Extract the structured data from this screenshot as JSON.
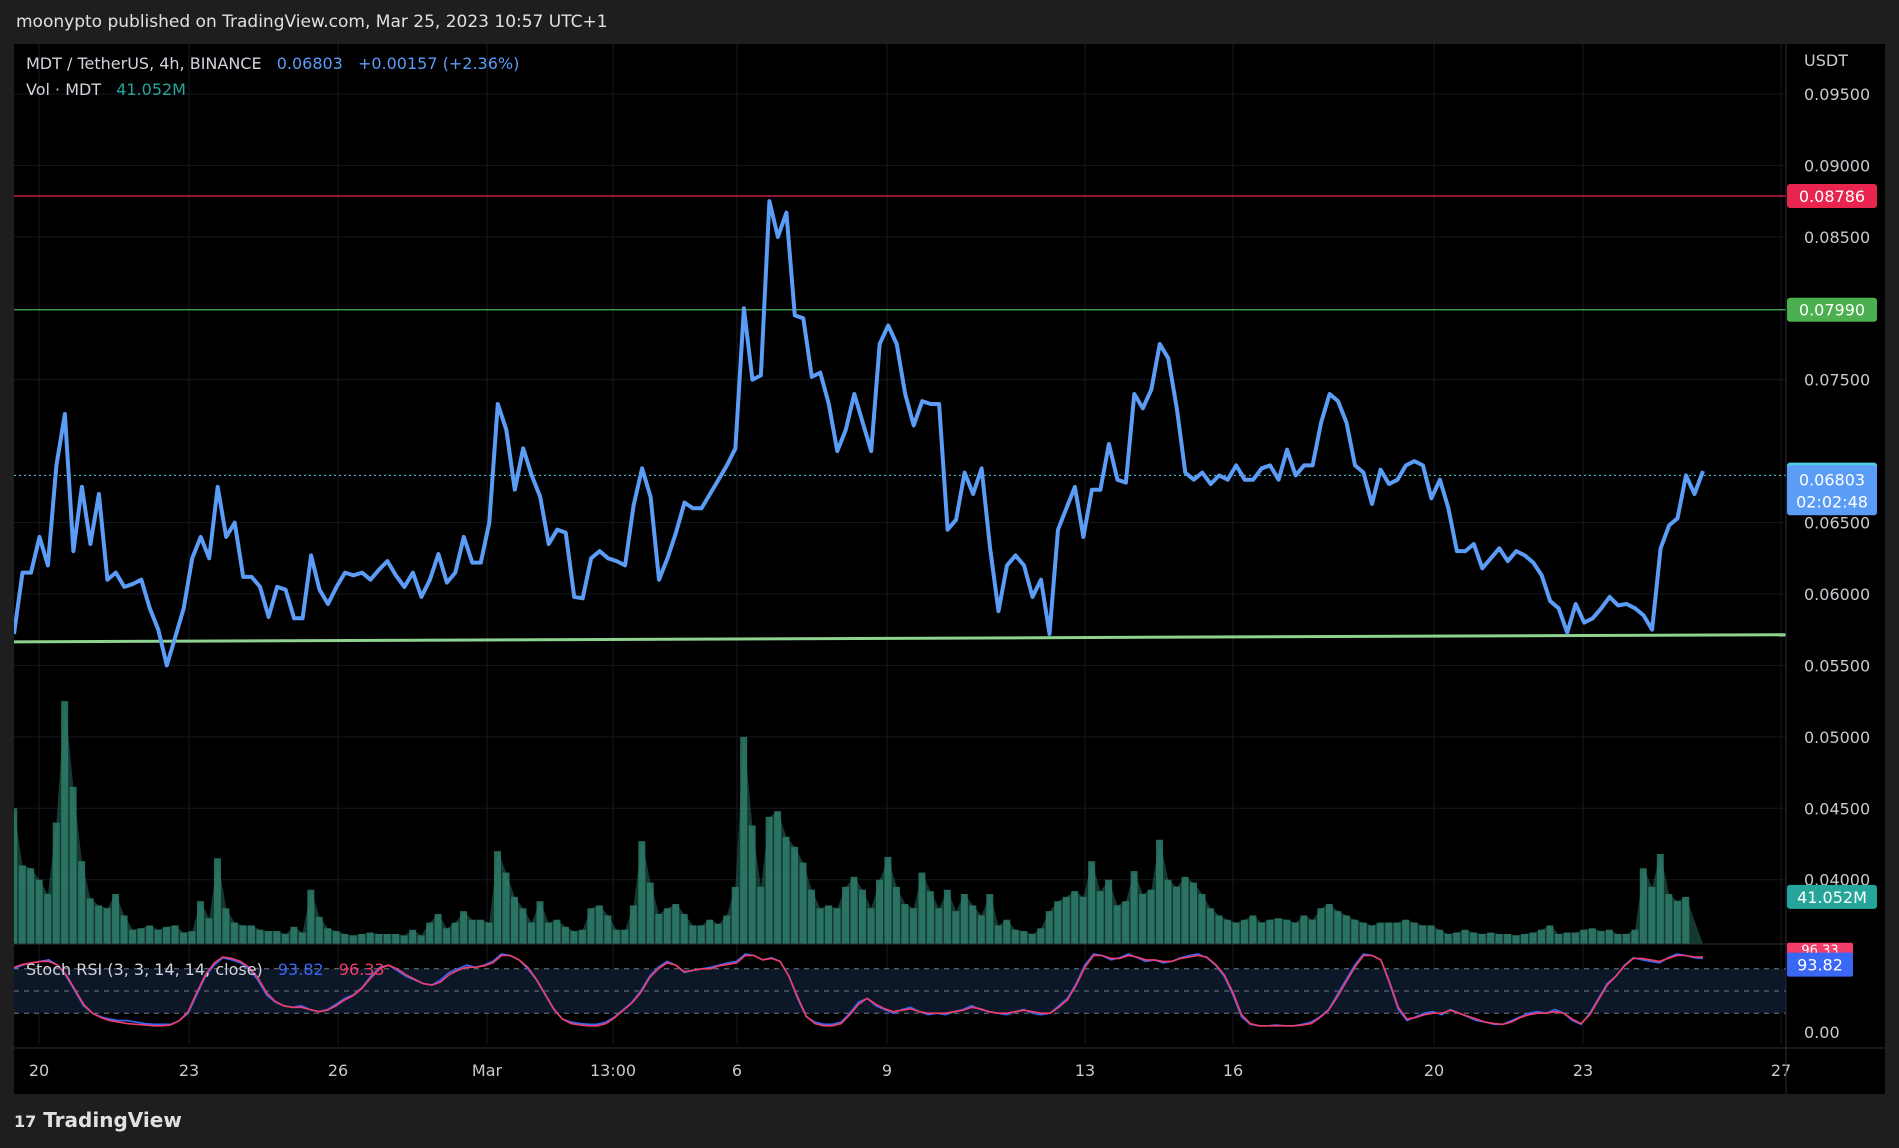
{
  "header": {
    "published_line": "moonypto published on TradingView.com, Mar 25, 2023 10:57 UTC+1"
  },
  "footer": {
    "brand": "TradingView"
  },
  "legend": {
    "symbol": "MDT / TetherUS, 4h, BINANCE",
    "last": "0.06803",
    "change": "+0.00157 (+2.36%)",
    "vol_label": "Vol · MDT",
    "vol_value": "41.052M",
    "stoch_label": "Stoch RSI (3, 3, 14, 14, close)",
    "stoch_k": "93.82",
    "stoch_d": "96.33"
  },
  "axis": {
    "currency": "USDT",
    "price_ticks": [
      "0.09500",
      "0.09000",
      "0.08500",
      "0.07500",
      "0.06500",
      "0.06000",
      "0.05500",
      "0.05000",
      "0.04500",
      "0.04000"
    ],
    "stoch_tick": "0.00",
    "x_ticks": [
      "20",
      "23",
      "26",
      "Mar",
      "13:00",
      "6",
      "9",
      "13",
      "16",
      "20",
      "23",
      "27"
    ]
  },
  "badges": {
    "resistance_high": "0.08786",
    "resistance_mid": "0.07990",
    "prev_close": "0.06836",
    "last_price": "0.06803",
    "countdown": "02:02:48",
    "volume": "41.052M",
    "stoch_k": "93.82",
    "stoch_d": "96.33"
  },
  "colors": {
    "price_line": "#5b9cf6",
    "resistance_red": "#e8254f",
    "resistance_green": "#4caf50",
    "support": "#8fd18f",
    "volume": "#2e7d6b",
    "stoch_k": "#3b67f5",
    "stoch_d": "#f23d6a",
    "prev_close": "#4dd0e1"
  },
  "chart_data": {
    "type": "line",
    "title": "MDT / TetherUS, 4h, BINANCE",
    "ylabel": "USDT",
    "ylim": [
      0.0355,
      0.0985
    ],
    "x_range": [
      "2023-02-19",
      "2023-03-27"
    ],
    "horizontal_lines": [
      0.08786,
      0.0799
    ],
    "support_line": {
      "from": [
        "2023-02-19",
        0.05665
      ],
      "to": [
        "2023-03-27",
        0.05715
      ]
    },
    "series": [
      {
        "values": [
          0.0572,
          0.0615,
          0.0615,
          0.064,
          0.062,
          0.069,
          0.0726,
          0.063,
          0.0675,
          0.0635,
          0.067,
          0.061,
          0.0615,
          0.0605,
          0.0607,
          0.061,
          0.059,
          0.0575,
          0.055,
          0.057,
          0.059,
          0.0625,
          0.064,
          0.0625,
          0.0675,
          0.064,
          0.065,
          0.0612,
          0.0612,
          0.0605,
          0.0584,
          0.0605,
          0.0603,
          0.0583,
          0.0583,
          0.0627,
          0.0603,
          0.0593,
          0.0605,
          0.0615,
          0.0613,
          0.0615,
          0.061,
          0.0617,
          0.0623,
          0.0613,
          0.0605,
          0.0615,
          0.0598,
          0.061,
          0.0628,
          0.0608,
          0.0615,
          0.064,
          0.0622,
          0.0622,
          0.065,
          0.0733,
          0.0715,
          0.0673,
          0.0702,
          0.0683,
          0.0668,
          0.0635,
          0.0645,
          0.0643,
          0.0598,
          0.0597,
          0.0625,
          0.063,
          0.0625,
          0.0623,
          0.062,
          0.0662,
          0.0688,
          0.0668,
          0.061,
          0.0625,
          0.0643,
          0.0664,
          0.066,
          0.066,
          0.067,
          0.068,
          0.069,
          0.0702,
          0.08,
          0.075,
          0.0753,
          0.0875,
          0.085,
          0.0867,
          0.0795,
          0.0793,
          0.0752,
          0.0755,
          0.0733,
          0.07,
          0.0715,
          0.074,
          0.072,
          0.07,
          0.0775,
          0.0788,
          0.0775,
          0.074,
          0.0718,
          0.0735,
          0.0733,
          0.0733,
          0.0645,
          0.0652,
          0.0685,
          0.067,
          0.0688,
          0.0632,
          0.0588,
          0.062,
          0.0627,
          0.062,
          0.0598,
          0.061,
          0.0572,
          0.0645,
          0.066,
          0.0675,
          0.064,
          0.0673,
          0.0673,
          0.0705,
          0.068,
          0.0678,
          0.074,
          0.073,
          0.0743,
          0.0775,
          0.0765,
          0.073,
          0.0685,
          0.068,
          0.0685,
          0.0677,
          0.0683,
          0.068,
          0.069,
          0.068,
          0.068,
          0.0688,
          0.069,
          0.068,
          0.0701,
          0.0683,
          0.069,
          0.069,
          0.072,
          0.074,
          0.0735,
          0.072,
          0.069,
          0.0685,
          0.0663,
          0.0687,
          0.0677,
          0.068,
          0.069,
          0.0693,
          0.069,
          0.0667,
          0.068,
          0.066,
          0.063,
          0.063,
          0.0635,
          0.0618,
          0.0625,
          0.0632,
          0.0623,
          0.063,
          0.0627,
          0.0622,
          0.0613,
          0.0595,
          0.059,
          0.0573,
          0.0593,
          0.058,
          0.0583,
          0.059,
          0.0598,
          0.0592,
          0.0593,
          0.059,
          0.0585,
          0.0575,
          0.0632,
          0.0648,
          0.0653,
          0.0683,
          0.067,
          0.0686
        ]
      }
    ],
    "volume": {
      "values": [
        0.045,
        0.041,
        0.0408,
        0.04,
        0.039,
        0.044,
        0.0525,
        0.0465,
        0.0413,
        0.0387,
        0.0382,
        0.038,
        0.039,
        0.0375,
        0.0365,
        0.0366,
        0.0368,
        0.0365,
        0.0367,
        0.0368,
        0.0363,
        0.0364,
        0.0385,
        0.0373,
        0.0415,
        0.038,
        0.037,
        0.0368,
        0.0368,
        0.0365,
        0.0364,
        0.0364,
        0.0362,
        0.0367,
        0.0363,
        0.0393,
        0.0374,
        0.0366,
        0.0364,
        0.0362,
        0.0361,
        0.0362,
        0.0363,
        0.0362,
        0.0362,
        0.0362,
        0.0361,
        0.0365,
        0.0361,
        0.037,
        0.0376,
        0.0366,
        0.037,
        0.0378,
        0.0372,
        0.0372,
        0.037,
        0.042,
        0.0405,
        0.0388,
        0.038,
        0.037,
        0.0385,
        0.037,
        0.0372,
        0.0367,
        0.0364,
        0.0365,
        0.038,
        0.0382,
        0.0375,
        0.0365,
        0.0365,
        0.0382,
        0.0427,
        0.0398,
        0.0376,
        0.038,
        0.0383,
        0.0376,
        0.0368,
        0.0368,
        0.0372,
        0.0369,
        0.0375,
        0.0395,
        0.05,
        0.0438,
        0.0395,
        0.0444,
        0.0448,
        0.043,
        0.0423,
        0.0412,
        0.0393,
        0.038,
        0.0382,
        0.038,
        0.0395,
        0.0402,
        0.0393,
        0.038,
        0.04,
        0.0416,
        0.0395,
        0.0383,
        0.038,
        0.0405,
        0.0392,
        0.038,
        0.0393,
        0.0378,
        0.039,
        0.0382,
        0.0375,
        0.039,
        0.0368,
        0.0372,
        0.0365,
        0.0364,
        0.0362,
        0.0366,
        0.0378,
        0.0385,
        0.0388,
        0.0392,
        0.0388,
        0.0413,
        0.0392,
        0.04,
        0.0382,
        0.0385,
        0.0406,
        0.039,
        0.0393,
        0.0428,
        0.04,
        0.0395,
        0.0402,
        0.0398,
        0.039,
        0.038,
        0.0375,
        0.0372,
        0.037,
        0.0372,
        0.0375,
        0.037,
        0.0372,
        0.0373,
        0.0372,
        0.037,
        0.0375,
        0.0372,
        0.038,
        0.0383,
        0.0378,
        0.0375,
        0.0372,
        0.037,
        0.0368,
        0.037,
        0.037,
        0.037,
        0.0372,
        0.037,
        0.0368,
        0.0368,
        0.0365,
        0.0362,
        0.0363,
        0.0365,
        0.0363,
        0.0362,
        0.0363,
        0.0362,
        0.0362,
        0.0361,
        0.0362,
        0.0363,
        0.0365,
        0.0368,
        0.0362,
        0.0363,
        0.0363,
        0.0365,
        0.0366,
        0.0364,
        0.0365,
        0.0362,
        0.0362,
        0.0365,
        0.0408,
        0.0395,
        0.0418,
        0.039,
        0.0385,
        0.0388
      ]
    },
    "stoch_rsi": {
      "k": [
        80,
        85,
        88,
        90,
        92,
        85,
        70,
        50,
        30,
        20,
        15,
        12,
        10,
        10,
        8,
        6,
        5,
        5,
        5,
        10,
        20,
        45,
        70,
        85,
        95,
        92,
        88,
        80,
        65,
        45,
        35,
        30,
        28,
        30,
        25,
        22,
        25,
        32,
        40,
        45,
        55,
        70,
        82,
        85,
        78,
        70,
        65,
        60,
        58,
        65,
        75,
        80,
        85,
        82,
        85,
        90,
        100,
        98,
        92,
        80,
        65,
        45,
        25,
        12,
        8,
        6,
        5,
        5,
        8,
        15,
        25,
        35,
        50,
        70,
        82,
        90,
        85,
        75,
        78,
        80,
        82,
        85,
        88,
        90,
        100,
        98,
        92,
        95,
        90,
        70,
        40,
        15,
        8,
        5,
        5,
        8,
        20,
        35,
        40,
        30,
        25,
        20,
        25,
        28,
        22,
        18,
        20,
        18,
        22,
        25,
        30,
        25,
        22,
        20,
        18,
        22,
        25,
        20,
        18,
        20,
        30,
        40,
        60,
        85,
        100,
        98,
        92,
        95,
        100,
        95,
        90,
        92,
        88,
        90,
        95,
        98,
        100,
        95,
        85,
        70,
        45,
        15,
        5,
        3,
        3,
        4,
        3,
        3,
        5,
        8,
        15,
        25,
        45,
        65,
        85,
        100,
        98,
        92,
        60,
        25,
        10,
        15,
        20,
        22,
        18,
        25,
        20,
        15,
        10,
        8,
        5,
        5,
        10,
        15,
        20,
        22,
        20,
        25,
        20,
        10,
        5,
        20,
        40,
        60,
        70,
        85,
        95,
        92,
        90,
        88,
        95,
        100,
        98,
        95,
        94
      ],
      "d": [
        82,
        86,
        88,
        90,
        90,
        85,
        72,
        52,
        32,
        20,
        14,
        10,
        8,
        6,
        5,
        4,
        3,
        3,
        4,
        10,
        22,
        48,
        72,
        88,
        96,
        94,
        90,
        82,
        68,
        48,
        36,
        30,
        28,
        28,
        25,
        22,
        24,
        30,
        38,
        44,
        54,
        68,
        80,
        85,
        80,
        72,
        66,
        60,
        58,
        62,
        72,
        78,
        82,
        82,
        84,
        88,
        98,
        98,
        92,
        82,
        66,
        46,
        26,
        12,
        6,
        4,
        3,
        3,
        6,
        14,
        24,
        34,
        48,
        68,
        80,
        88,
        85,
        76,
        78,
        80,
        80,
        84,
        86,
        88,
        98,
        98,
        92,
        94,
        90,
        70,
        42,
        16,
        6,
        3,
        3,
        6,
        18,
        32,
        40,
        32,
        26,
        22,
        24,
        26,
        22,
        20,
        20,
        20,
        22,
        24,
        28,
        26,
        22,
        20,
        20,
        22,
        24,
        22,
        20,
        20,
        28,
        38,
        58,
        82,
        98,
        98,
        94,
        94,
        98,
        96,
        92,
        92,
        90,
        90,
        94,
        96,
        98,
        96,
        86,
        72,
        48,
        18,
        6,
        3,
        3,
        3,
        3,
        3,
        4,
        6,
        14,
        24,
        42,
        62,
        82,
        98,
        98,
        92,
        62,
        28,
        12,
        14,
        18,
        20,
        20,
        24,
        20,
        16,
        12,
        8,
        6,
        5,
        8,
        14,
        18,
        20,
        20,
        22,
        20,
        12,
        6,
        18,
        38,
        58,
        70,
        84,
        94,
        94,
        92,
        90,
        94,
        98,
        98,
        96,
        96
      ]
    }
  }
}
